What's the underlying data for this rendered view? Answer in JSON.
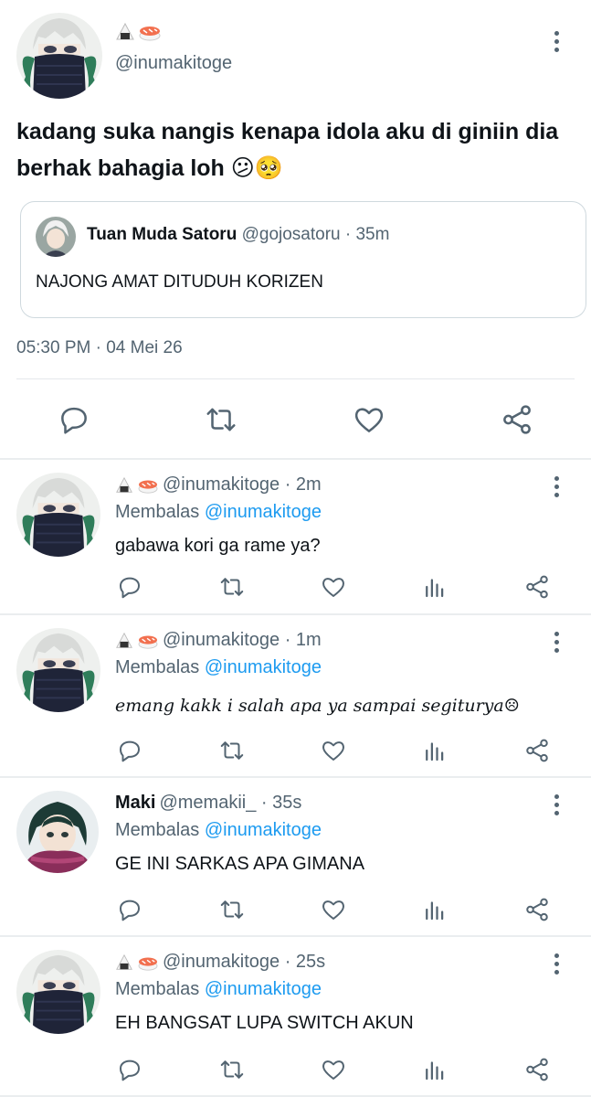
{
  "main_tweet": {
    "handle": "@inumakitoge",
    "text": "kadang suka nangis kenapa idola aku di giniin dia berhak bahagia loh 😕🥺",
    "quote": {
      "name": "Tuan Muda Satoru",
      "meta": "@gojosatoru · 35m",
      "text": "NAJONG AMAT DITUDUH KORIZEN"
    },
    "timestamp": "05:30 PM · 04 Mei 26",
    "actions": [
      "reply-icon",
      "retweet-icon",
      "like-icon",
      "share-icon"
    ]
  },
  "replies": [
    {
      "name": "",
      "handle_meta": "@inumakitoge · 2m",
      "replying_prefix": "Membalas",
      "replying_to": "@inumakitoge",
      "text": "gabawa kori ga rame ya?"
    },
    {
      "name": "",
      "handle_meta": "@inumakitoge · 1m",
      "replying_prefix": "Membalas",
      "replying_to": "@inumakitoge",
      "text": "emang kakk i salah apa ya sampai segiturya☹"
    },
    {
      "name": "Maki",
      "handle_meta": "@memakii_ · 35s",
      "replying_prefix": "Membalas",
      "replying_to": "@inumakitoge",
      "text": "GE INI SARKAS APA GIMANA"
    },
    {
      "name": "",
      "handle_meta": "@inumakitoge · 25s",
      "replying_prefix": "Membalas",
      "replying_to": "@inumakitoge",
      "text": "EH BANGSAT LUPA SWITCH AKUN"
    }
  ],
  "reply_actions": [
    "reply-icon",
    "retweet-icon",
    "like-icon",
    "views-icon",
    "share-icon"
  ],
  "colors": {
    "text": "#0f1419",
    "secondary": "#536471",
    "link": "#1d9bf0",
    "divider": "#eaedef"
  }
}
